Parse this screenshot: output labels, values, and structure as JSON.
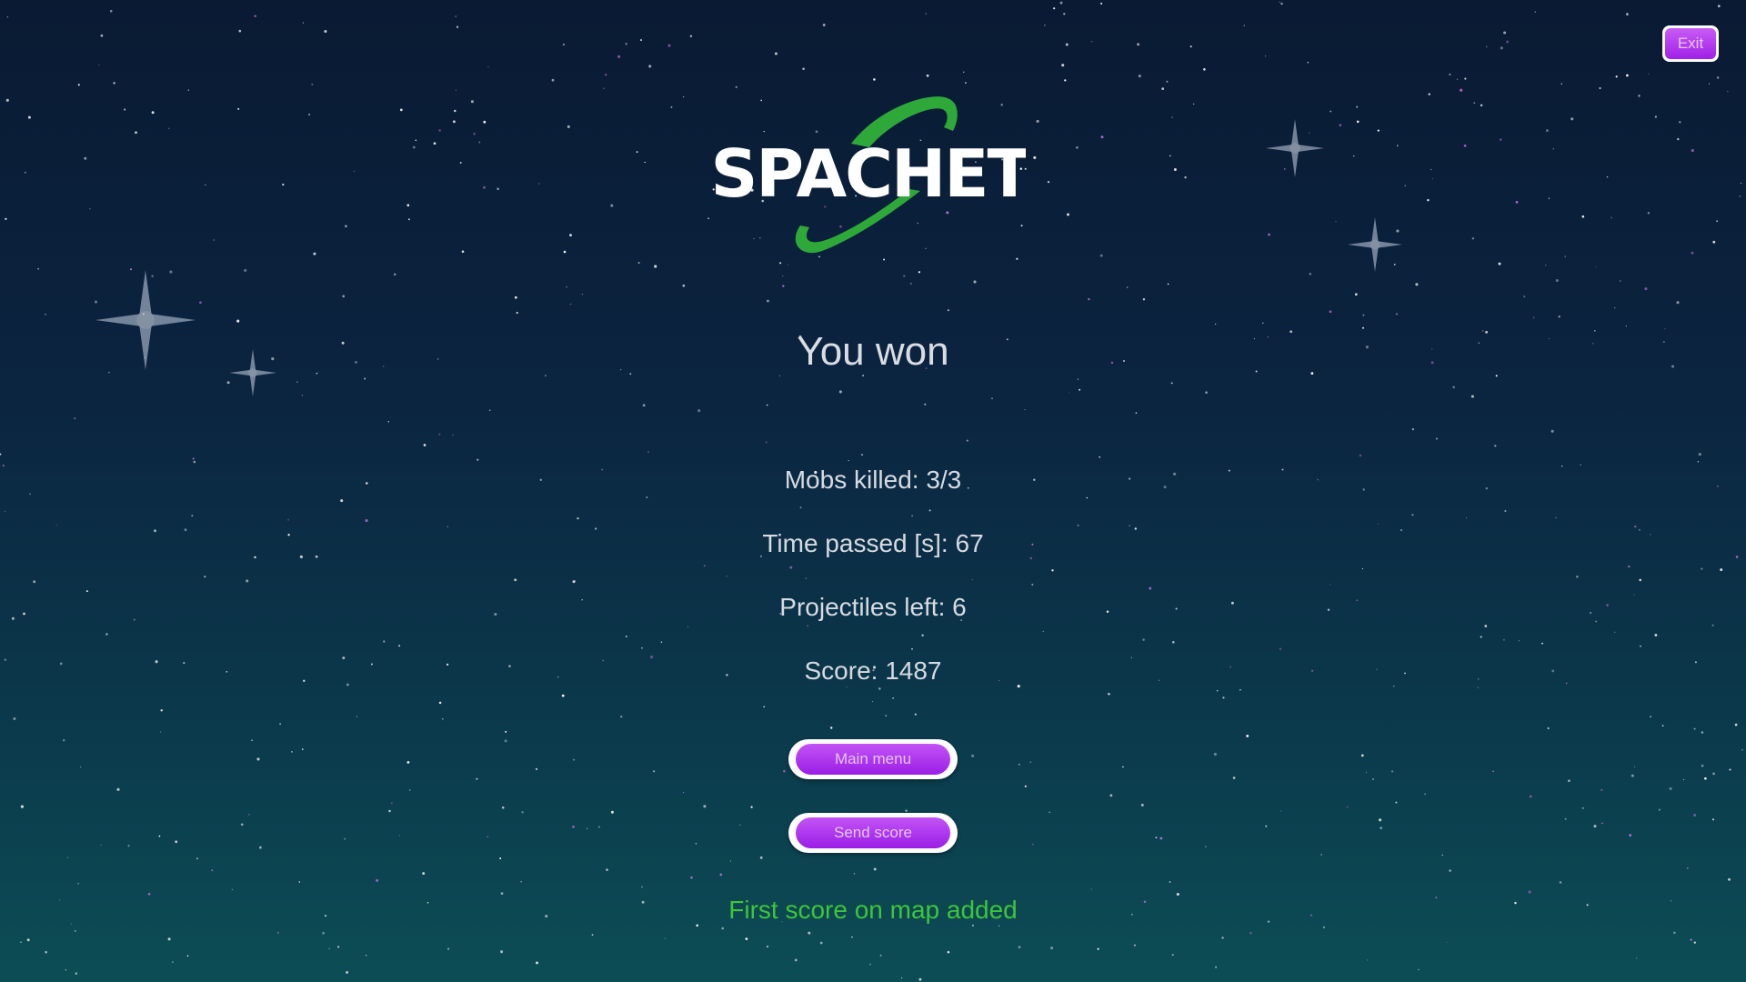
{
  "colors": {
    "accent_purple": "#a020e8",
    "logo_green": "#2fa83a",
    "status_green": "#3fc43a",
    "text": "#d6dbe2"
  },
  "header": {
    "exit_label": "Exit"
  },
  "logo": {
    "text": "SPACHET",
    "icon": "planet-orbit-icon"
  },
  "result": {
    "headline": "You won",
    "stats": [
      "Mobs killed: 3/3",
      "Time passed [s]: 67",
      "Projectiles left: 6",
      "Score: 1487"
    ]
  },
  "actions": {
    "main_menu_label": "Main menu",
    "send_score_label": "Send score"
  },
  "status_message": "First score on map added"
}
